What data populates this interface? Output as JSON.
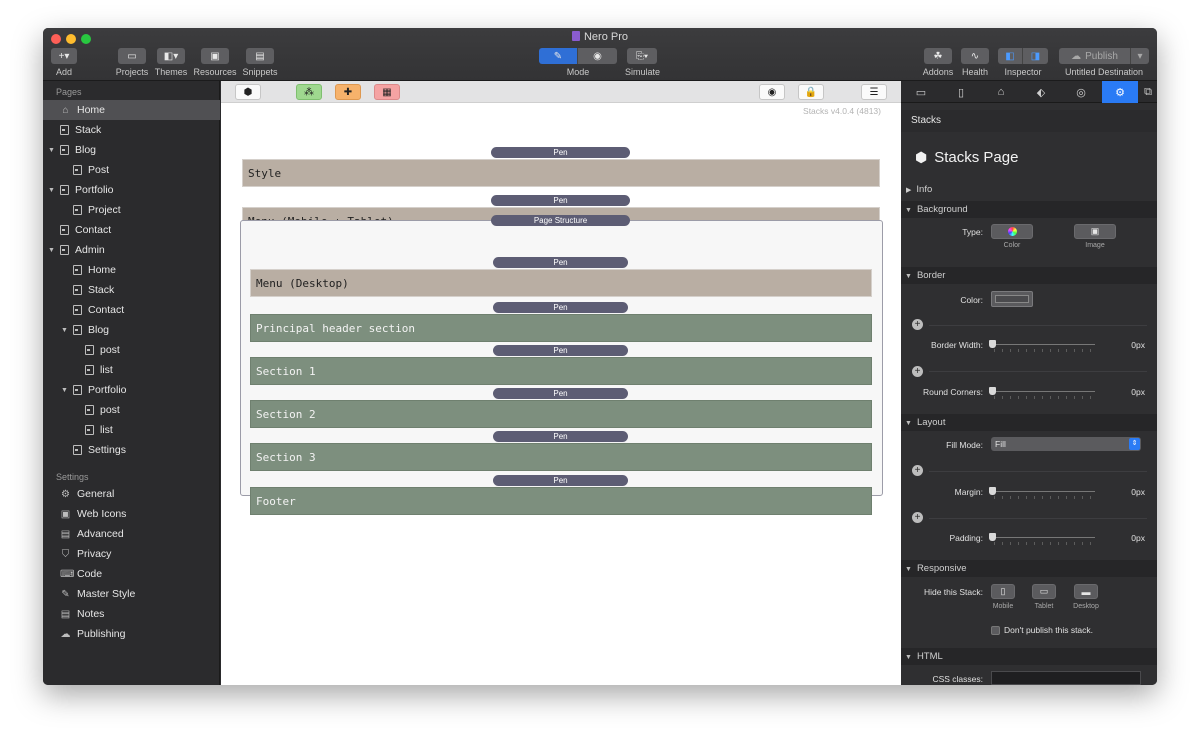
{
  "window": {
    "title": "Nero Pro"
  },
  "toolbar": {
    "add_label": "Add",
    "projects_label": "Projects",
    "themes_label": "Themes",
    "resources_label": "Resources",
    "snippets_label": "Snippets",
    "mode_label": "Mode",
    "simulate_label": "Simulate",
    "addons_label": "Addons",
    "health_label": "Health",
    "inspector_label": "Inspector",
    "publish_label": "Publish",
    "destination_label": "Untitled Destination"
  },
  "sidebar": {
    "pages_header": "Pages",
    "pages": [
      {
        "label": "Home"
      },
      {
        "label": "Stack"
      },
      {
        "label": "Blog"
      },
      {
        "label": "Post"
      },
      {
        "label": "Portfolio"
      },
      {
        "label": "Project"
      },
      {
        "label": "Contact"
      },
      {
        "label": "Admin"
      },
      {
        "label": "Home"
      },
      {
        "label": "Stack"
      },
      {
        "label": "Contact"
      },
      {
        "label": "Blog"
      },
      {
        "label": "post"
      },
      {
        "label": "list"
      },
      {
        "label": "Portfolio"
      },
      {
        "label": "post"
      },
      {
        "label": "list"
      },
      {
        "label": "Settings"
      }
    ],
    "settings_header": "Settings",
    "settings": [
      {
        "label": "General",
        "icon": "gear-icon"
      },
      {
        "label": "Web Icons",
        "icon": "image-icon"
      },
      {
        "label": "Advanced",
        "icon": "advanced-icon"
      },
      {
        "label": "Privacy",
        "icon": "shield-icon"
      },
      {
        "label": "Code",
        "icon": "code-icon"
      },
      {
        "label": "Master Style",
        "icon": "brush-icon"
      },
      {
        "label": "Notes",
        "icon": "notes-icon"
      },
      {
        "label": "Publishing",
        "icon": "cloud-icon"
      }
    ]
  },
  "canvas": {
    "version": "Stacks v4.0.4 (4813)",
    "pen_label": "Pen",
    "page_structure_label": "Page Structure",
    "top_stacks": [
      {
        "label": "Style"
      },
      {
        "label": "Menu (Mobile + Tablet)"
      }
    ],
    "inner_stacks": [
      {
        "label": "Menu (Desktop)",
        "tone": "tan"
      },
      {
        "label": "Principal header section",
        "tone": "green"
      },
      {
        "label": "Section 1",
        "tone": "green"
      },
      {
        "label": "Section 2",
        "tone": "green"
      },
      {
        "label": "Section 3",
        "tone": "green"
      },
      {
        "label": "Footer",
        "tone": "green"
      }
    ],
    "colors": {
      "tan": "#b9aea3",
      "green": "#7d8f7e",
      "pen": "#5d5d74"
    }
  },
  "inspector": {
    "panel_title": "Stacks",
    "page_title": "Stacks Page",
    "info_label": "Info",
    "background": {
      "heading": "Background",
      "type_label": "Type:",
      "color_option": "Color",
      "image_option": "Image"
    },
    "border": {
      "heading": "Border",
      "color_label": "Color:",
      "width_label": "Border Width:",
      "width_value": "0px",
      "corners_label": "Round Corners:",
      "corners_value": "0px"
    },
    "layout": {
      "heading": "Layout",
      "fill_mode_label": "Fill Mode:",
      "fill_mode_value": "Fill",
      "margin_label": "Margin:",
      "margin_value": "0px",
      "padding_label": "Padding:",
      "padding_value": "0px"
    },
    "responsive": {
      "heading": "Responsive",
      "hide_label": "Hide this Stack:",
      "mobile_label": "Mobile",
      "tablet_label": "Tablet",
      "desktop_label": "Desktop",
      "dont_publish_label": "Don't publish this stack."
    },
    "html": {
      "heading": "HTML",
      "css_classes_label": "CSS classes:"
    },
    "accent": "#2a7bf5"
  }
}
